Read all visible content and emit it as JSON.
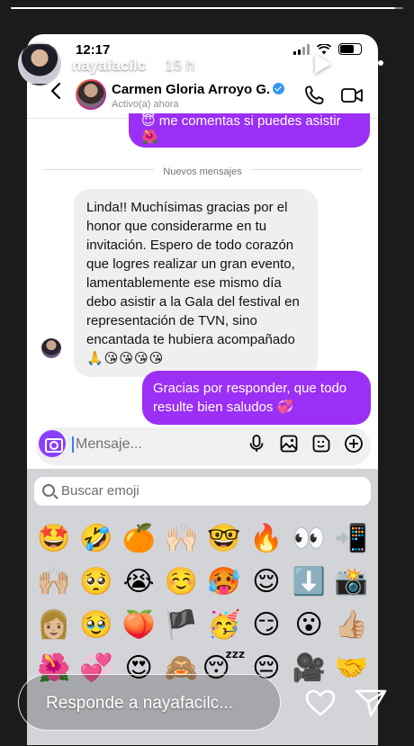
{
  "story": {
    "username": "nayafacilc",
    "time_ago": "15 h",
    "progress": 0.98,
    "reply_placeholder": "Responde a nayafacilc...",
    "icons": [
      "play-icon",
      "more-icon",
      "heart-icon",
      "send-icon"
    ]
  },
  "phone": {
    "time": "12:17"
  },
  "chat": {
    "contact_name": "Carmen Gloria Arroyo G.",
    "contact_status": "Activo(a) ahora",
    "prev_message_line1": "😇 me comentas si puedes asistir",
    "prev_message_line2": "🌺",
    "divider_label": "Nuevos mensajes",
    "incoming_text": "Linda!! Muchísimas gracias por el honor que considerarme en tu invitación.  Espero de todo corazón que logres realizar un gran evento, lamentablemente ese mismo día debo asistir a la Gala del festival en representación de TVN, sino encantada te hubiera acompañado",
    "incoming_emojis": "🙏😘😘😘😘",
    "outgoing_text": "Gracias por responder, que todo resulte bien saludos 💞",
    "composer_placeholder": "Mensaje...",
    "accent_color": "#9b2ff5"
  },
  "keyboard": {
    "search_placeholder": "Buscar emoji",
    "emojis": [
      "🤩",
      "🤣",
      "🍊",
      "🙌🏻",
      "🤓",
      "🔥",
      "👀",
      "📲",
      "🙌🏼",
      "🥺",
      "😭",
      "☺️",
      "🥵",
      "😌",
      "⬇️",
      "📸",
      "👩🏼",
      "🥹",
      "🍑",
      "🏴",
      "🥳",
      "😏",
      "😮",
      "👍🏼",
      "🌺",
      "💞",
      "😍",
      "🙈",
      "😴",
      "😔",
      "🎥",
      "🤝"
    ]
  }
}
